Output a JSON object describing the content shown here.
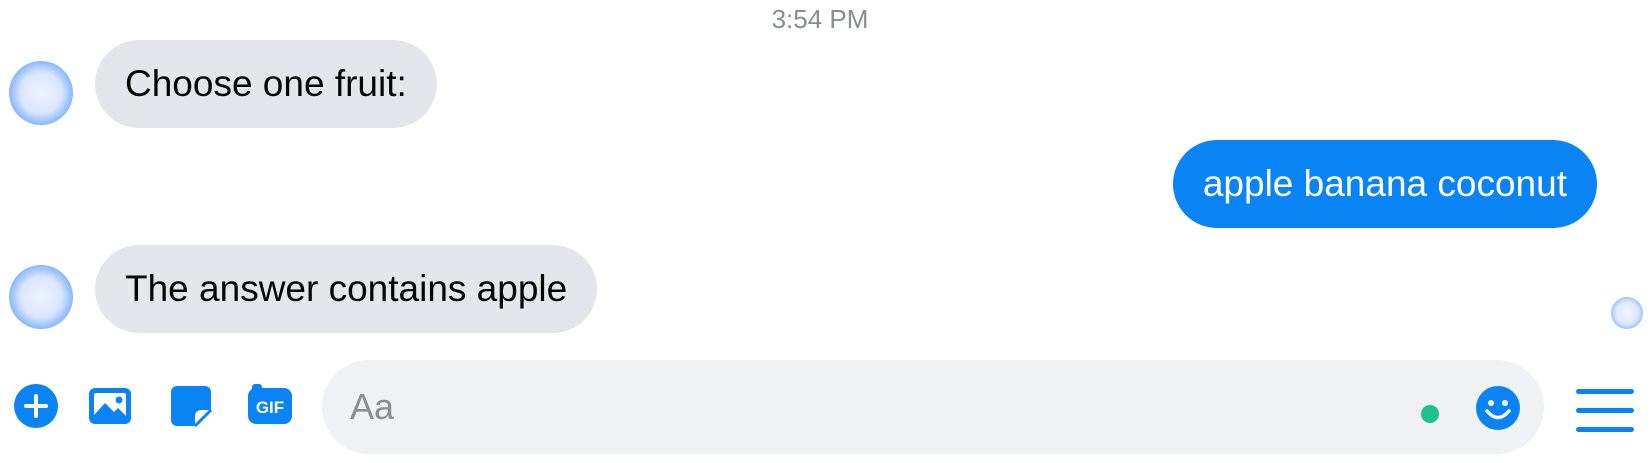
{
  "chat": {
    "timestamp": "3:54 PM",
    "messages": [
      {
        "direction": "incoming",
        "text": "Choose one fruit:"
      },
      {
        "direction": "outgoing",
        "text": "apple banana coconut"
      },
      {
        "direction": "incoming",
        "text": "The answer contains apple"
      }
    ]
  },
  "composer": {
    "placeholder": "Aa",
    "value": "",
    "tools": [
      "plus-icon",
      "image-icon",
      "sticker-icon",
      "gif-icon"
    ],
    "gif_label": "GIF",
    "emoji_icon": "smiley-icon",
    "menu_icon": "hamburger-menu-icon"
  },
  "colors": {
    "accent": "#0a84f5",
    "incoming_bubble": "#e4e6eb",
    "online_dot": "#1cc18f",
    "input_bg": "#f0f2f5"
  }
}
